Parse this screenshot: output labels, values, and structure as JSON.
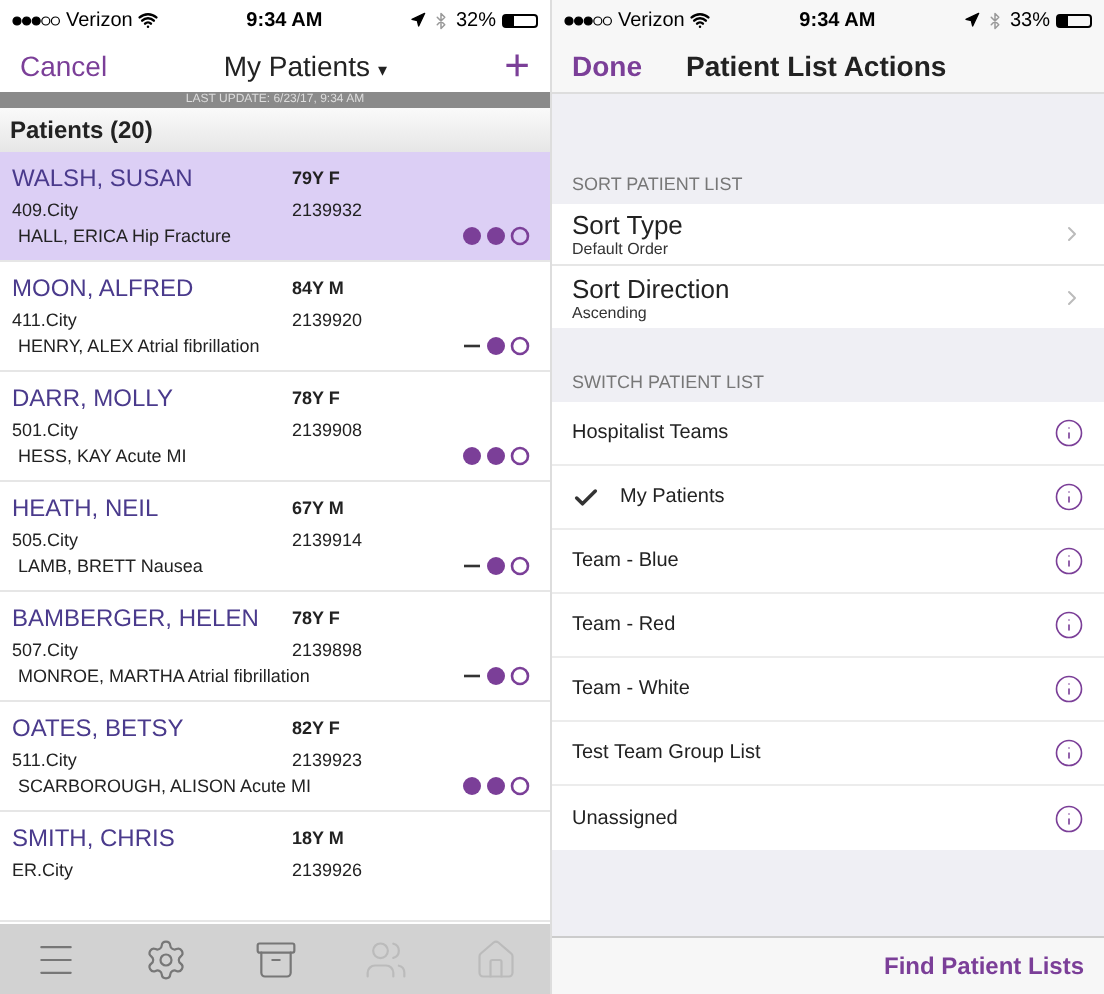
{
  "left_screen": {
    "status_bar": {
      "carrier": "Verizon",
      "time": "9:34 AM",
      "battery": "32%"
    },
    "nav": {
      "cancel": "Cancel",
      "title": "My Patients",
      "caret": "▾",
      "add": "+"
    },
    "last_update": "LAST UPDATE: 6/23/17, 9:34 AM",
    "list_header": "Patients (20)",
    "patients": [
      {
        "name": "WALSH, SUSAN",
        "age_sex": "79Y F",
        "location": "409.City",
        "mrn": "2139932",
        "detail": "HALL, ERICA Hip Fracture",
        "selected": true,
        "indicators": [
          {
            "kind": "filled"
          },
          {
            "kind": "filled"
          },
          {
            "kind": "empty"
          }
        ]
      },
      {
        "name": "MOON, ALFRED",
        "age_sex": "84Y M",
        "location": "411.City",
        "mrn": "2139920",
        "detail": "HENRY, ALEX Atrial fibrillation",
        "selected": false,
        "indicators": [
          {
            "kind": "dash"
          },
          {
            "kind": "filled"
          },
          {
            "kind": "empty"
          }
        ]
      },
      {
        "name": "DARR, MOLLY",
        "age_sex": "78Y F",
        "location": "501.City",
        "mrn": "2139908",
        "detail": "HESS, KAY Acute MI",
        "selected": false,
        "indicators": [
          {
            "kind": "filled"
          },
          {
            "kind": "filled"
          },
          {
            "kind": "empty"
          }
        ]
      },
      {
        "name": "HEATH, NEIL",
        "age_sex": "67Y M",
        "location": "505.City",
        "mrn": "2139914",
        "detail": "LAMB, BRETT Nausea",
        "selected": false,
        "indicators": [
          {
            "kind": "dash"
          },
          {
            "kind": "filled"
          },
          {
            "kind": "empty"
          }
        ]
      },
      {
        "name": "BAMBERGER, HELEN",
        "age_sex": "78Y F",
        "location": "507.City",
        "mrn": "2139898",
        "detail": "MONROE, MARTHA Atrial fibrillation",
        "selected": false,
        "indicators": [
          {
            "kind": "dash"
          },
          {
            "kind": "filled"
          },
          {
            "kind": "empty"
          }
        ]
      },
      {
        "name": "OATES, BETSY",
        "age_sex": "82Y F",
        "location": "511.City",
        "mrn": "2139923",
        "detail": "SCARBOROUGH, ALISON Acute MI",
        "selected": false,
        "indicators": [
          {
            "kind": "filled"
          },
          {
            "kind": "filled"
          },
          {
            "kind": "empty"
          }
        ]
      },
      {
        "name": "SMITH, CHRIS",
        "age_sex": "18Y M",
        "location": "ER.City",
        "mrn": "2139926",
        "selected": false
      }
    ],
    "tab_bar": [
      {
        "disabled": false
      },
      {
        "disabled": false
      },
      {
        "disabled": false
      },
      {
        "disabled": true
      },
      {
        "disabled": true
      }
    ]
  },
  "right_screen": {
    "status_bar": {
      "carrier": "Verizon",
      "time": "9:34 AM",
      "battery": "33%"
    },
    "nav": {
      "done": "Done",
      "title": "Patient List Actions"
    },
    "sort_section": {
      "header": "SORT PATIENT LIST",
      "rows": [
        {
          "title": "Sort Type",
          "value": "Default Order"
        },
        {
          "title": "Sort Direction",
          "value": "Ascending"
        }
      ]
    },
    "switch_section": {
      "header": "SWITCH PATIENT LIST",
      "lists": [
        {
          "label": "Hospitalist Teams",
          "selected": false
        },
        {
          "label": "My Patients",
          "selected": true
        },
        {
          "label": "Team - Blue",
          "selected": false
        },
        {
          "label": "Team - Red",
          "selected": false
        },
        {
          "label": "Team - White",
          "selected": false
        },
        {
          "label": "Test Team Group List",
          "selected": false
        },
        {
          "label": "Unassigned",
          "selected": false
        }
      ]
    },
    "footer_link": "Find Patient Lists"
  }
}
